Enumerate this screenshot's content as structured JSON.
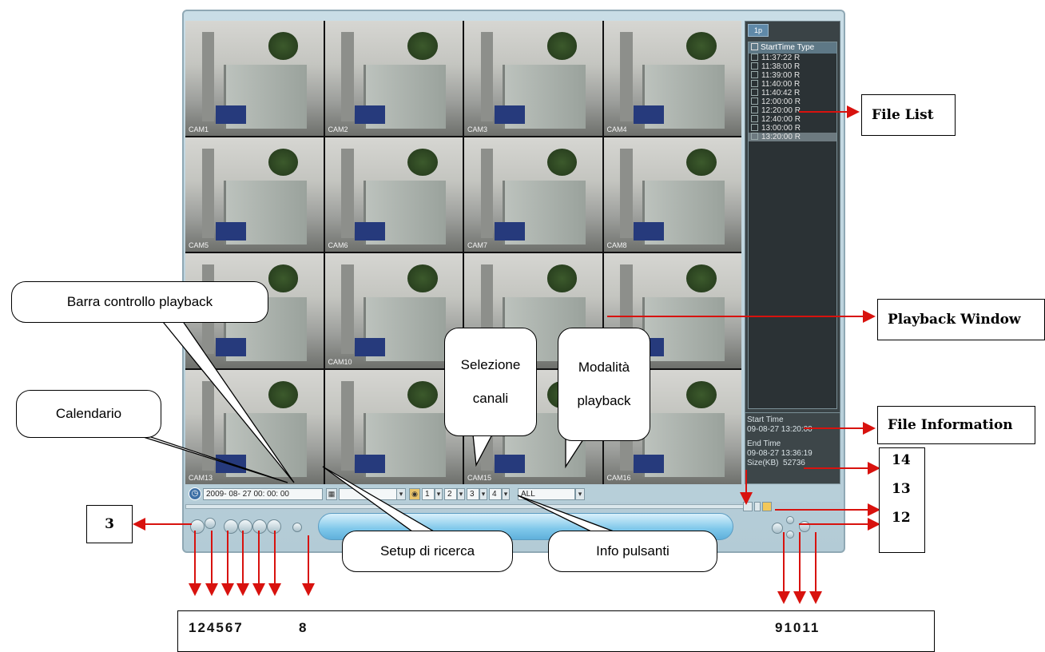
{
  "cameras": [
    "CAM1",
    "CAM2",
    "CAM3",
    "CAM4",
    "CAM5",
    "CAM6",
    "CAM7",
    "CAM8",
    "",
    "CAM10",
    "",
    "",
    "CAM13",
    "",
    "CAM15",
    "CAM16"
  ],
  "right_panel": {
    "tab": "1p",
    "file_list_header": "StartTime Type",
    "files": [
      {
        "time": "11:37:22",
        "type": "R"
      },
      {
        "time": "11:38:00",
        "type": "R"
      },
      {
        "time": "11:39:00",
        "type": "R"
      },
      {
        "time": "11:40:00",
        "type": "R"
      },
      {
        "time": "11:40:42",
        "type": "R"
      },
      {
        "time": "12:00:00",
        "type": "R"
      },
      {
        "time": "12:20:00",
        "type": "R"
      },
      {
        "time": "12:40:00",
        "type": "R"
      },
      {
        "time": "13:00:00",
        "type": "R"
      },
      {
        "time": "13:20:00",
        "type": "R"
      }
    ],
    "selected_file_index": 9,
    "file_info": {
      "start_label": "Start Time",
      "start_value": "09-08-27 13:20:00",
      "end_label": "End Time",
      "end_value": "09-08-27 13:36:19",
      "size_label": "Size(KB)",
      "size_value": "52736"
    }
  },
  "search_bar": {
    "datetime": "2009- 08- 27 00: 00: 00",
    "channels": [
      "1",
      "2",
      "3",
      "4"
    ],
    "mode": "ALL"
  },
  "callouts": {
    "barra": "Barra controllo playback",
    "calendario": "Calendario",
    "selezione_1": "Selezione",
    "selezione_2": "canali",
    "modalita_1": "Modalità",
    "modalita_2": "playback",
    "setup": "Setup di ricerca",
    "info": "Info pulsanti"
  },
  "labels": {
    "file_list": "File List",
    "playback_window": "Playback Window",
    "file_information": "File Information",
    "n3": "3",
    "n14": "14",
    "n13": "13",
    "n12": "12",
    "numbers_left": "124567",
    "number_8": "8",
    "numbers_right": "91011"
  },
  "colors": {
    "arrow": "#d8120e"
  }
}
